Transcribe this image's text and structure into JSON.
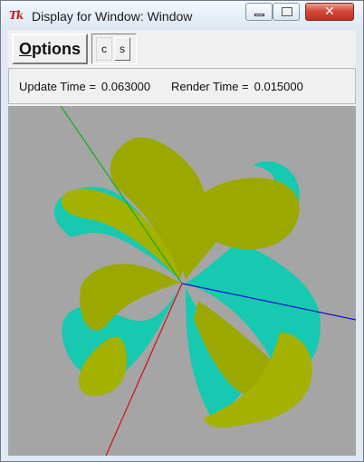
{
  "window": {
    "title": "Display for Window: Window",
    "app_icon_text": "Tk",
    "close_glyph": "✕"
  },
  "toolbar": {
    "options_label_first": "O",
    "options_label_rest": "ptions",
    "toggle_c_label": "c",
    "toggle_s_label": "s"
  },
  "status": {
    "update_label": "Update Time =",
    "update_value": "0.063000",
    "render_label": "Render Time =",
    "render_value": "0.015000"
  },
  "viewport": {
    "background": "#a5a5a5",
    "axis_colors": {
      "x": "#1010d0",
      "y": "#10b010",
      "z": "#d01010"
    },
    "ribbon_colors": {
      "outer": "#9ba800",
      "inner": "#17c9b0"
    }
  }
}
